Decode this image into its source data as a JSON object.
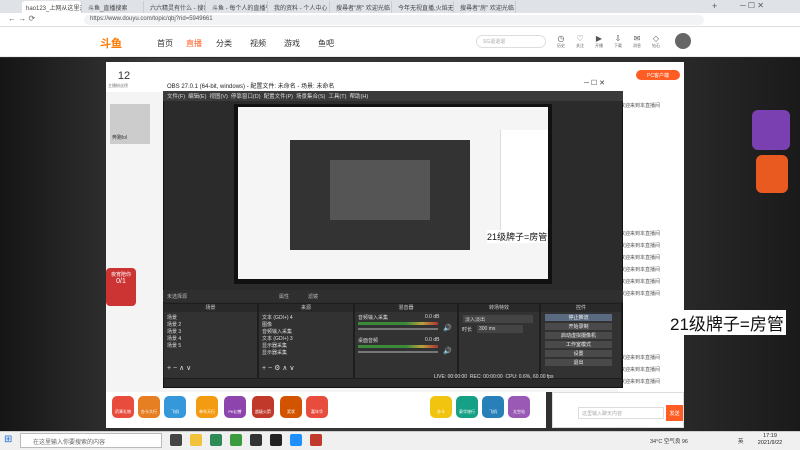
{
  "browser": {
    "tabs": [
      "hao123_上网从这里开始",
      "斗鱼_直播搜索",
      "六六精灵有什么 - 搜索",
      "斗鱼 - 每个人的直播平台",
      "我的资料 - 个人中心 - 斗鱼",
      "搜尋者\"房\" 欢迎光临",
      "今年无视直播,火焰无视直播",
      "搜尋者\"房\" 欢迎光临"
    ],
    "new_tab": "+",
    "url": "https://www.douyu.com/topic/qbj?rid=5949661"
  },
  "site": {
    "logo": "斗鱼",
    "nav": [
      "首页",
      "直播",
      "分类",
      "视频",
      "游戏",
      "鱼吧"
    ],
    "search_placeholder": "SG退退退",
    "icons": [
      "历史",
      "关注",
      "开播",
      "下载",
      "消息",
      "钻石",
      "开播"
    ]
  },
  "room": {
    "count": "12",
    "count_label": "主播粉丝榜",
    "gift_promo": "夜宵陪你",
    "gift_promo_count": "0/1",
    "streamer_tag": "奔跑lol",
    "pc_tag": "PC客户端",
    "gift_label": "礼物",
    "welcome_tip": "欢迎来到本直播间"
  },
  "obs": {
    "title": "OBS 27.0.1 (64-bit, windows) - 配置文件: 未命名 - 场景: 未命名",
    "menu": [
      "文件(F)",
      "编辑(E)",
      "视图(V)",
      "停靠窗口(D)",
      "配置文件(P)",
      "场景集合(S)",
      "工具(T)",
      "帮助(H)"
    ],
    "no_source": "未选择源",
    "props": "属性",
    "filters": "滤镜",
    "docks": {
      "scenes": "场景",
      "sources": "来源",
      "mixer": "混音器",
      "transitions": "转场特效",
      "controls": "控件"
    },
    "scenes": [
      "场景",
      "场景 2",
      "场景 3",
      "场景 4",
      "场景 5"
    ],
    "sources": [
      "文本 (GDI+) 4",
      "图像",
      "音频输入采集",
      "文本 (GDI+) 3",
      "显示器采集",
      "显示器采集"
    ],
    "mixer": {
      "ch1": "音频输入采集",
      "ch1_db": "0.0 dB",
      "ch2": "桌面音频",
      "ch2_db": "0.0 dB"
    },
    "transition": {
      "type": "淡入淡出",
      "duration_label": "时长",
      "duration": "300 ms"
    },
    "controls": [
      "停止推流",
      "开始录制",
      "启动虚拟摄像机",
      "工作室模式",
      "设置",
      "退出"
    ],
    "status": {
      "live": "LIVE: 00:00:00",
      "rec": "REC: 00:00:00",
      "cpu": "CPU: 0.6%, 60.00 fps"
    }
  },
  "captions": {
    "big": "21级牌子=房管",
    "mid": "21级牌子=房管"
  },
  "gifts": [
    "药膏礼物",
    "办卡大行",
    "飞机",
    "单车天行",
    "PK幻兽",
    "超级火箭",
    "奖状",
    "嘉年华",
    "办卡",
    "豪华旅行",
    "飞机",
    "太空站"
  ],
  "chat": {
    "placeholder": "这里输入聊天内容",
    "send": "发送"
  },
  "taskbar": {
    "search": "在这里输入你要搜索的内容",
    "weather": "34°C 空气良 96",
    "lang": "英",
    "time": "17:19",
    "date": "2021/9/22"
  },
  "colors": {
    "accent": "#ff5d23",
    "obs_bg": "#2b2b2b",
    "live_btn": "#5a6a80"
  }
}
